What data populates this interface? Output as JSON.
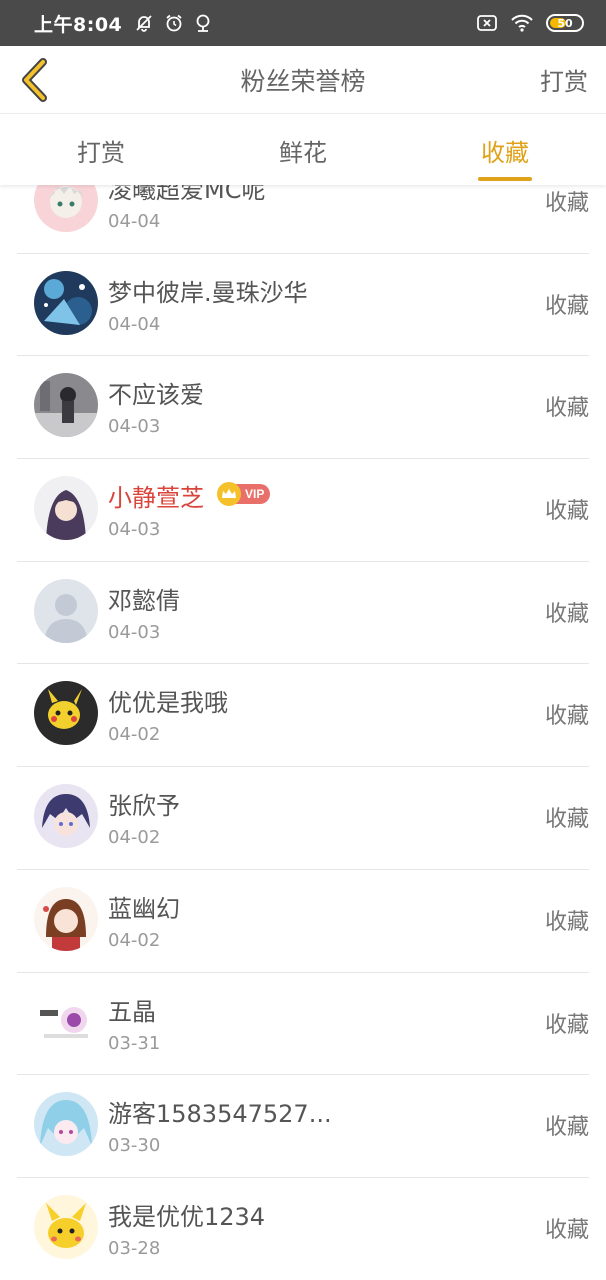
{
  "status_bar": {
    "time": "上午8:04",
    "battery": "50",
    "battery_color": "#f5b800"
  },
  "header": {
    "title": "粉丝荣誉榜",
    "action": "打赏",
    "back_icon": "chevron-left-icon"
  },
  "tabs": [
    {
      "label": "打赏",
      "active": false
    },
    {
      "label": "鲜花",
      "active": false
    },
    {
      "label": "收藏",
      "active": true
    }
  ],
  "accent_color": "#e0a21a",
  "vip_name_color": "#d9443b",
  "list": [
    {
      "name": "凌曦超爱MC呢",
      "date": "04-04",
      "action": "收藏"
    },
    {
      "name": "梦中彼岸.曼珠沙华",
      "date": "04-04",
      "action": "收藏"
    },
    {
      "name": "不应该爱",
      "date": "04-03",
      "action": "收藏"
    },
    {
      "name": "小静萱芝",
      "date": "04-03",
      "action": "收藏",
      "vip": true,
      "vip_label": "VIP"
    },
    {
      "name": "邓懿倩",
      "date": "04-03",
      "action": "收藏"
    },
    {
      "name": "优优是我哦",
      "date": "04-02",
      "action": "收藏"
    },
    {
      "name": "张欣予",
      "date": "04-02",
      "action": "收藏"
    },
    {
      "name": "蓝幽幻",
      "date": "04-02",
      "action": "收藏"
    },
    {
      "name": "五晶",
      "date": "03-31",
      "action": "收藏"
    },
    {
      "name": "游客1583547527...",
      "date": "03-30",
      "action": "收藏"
    },
    {
      "name": "我是优优1234",
      "date": "03-28",
      "action": "收藏"
    }
  ]
}
